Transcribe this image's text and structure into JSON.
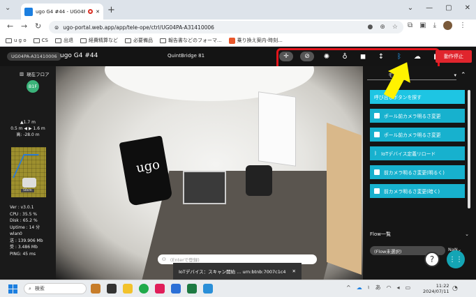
{
  "browser": {
    "tab_title": "ugo G4 #44 - UG04PA-A31...",
    "new_tab": "+",
    "url": "ugo-portal.web.app/app/tele-ope/ctrl/UG04PA-A31410006",
    "window_controls": [
      "⌄",
      "—",
      "▢",
      "✕"
    ],
    "bookmarks": [
      {
        "label": "u g o",
        "type": "folder"
      },
      {
        "label": "CS",
        "type": "folder"
      },
      {
        "label": "出退",
        "type": "folder"
      },
      {
        "label": "経費精算など",
        "type": "folder"
      },
      {
        "label": "必要備品",
        "type": "folder"
      },
      {
        "label": "報告書などのフォーマ...",
        "type": "folder"
      },
      {
        "label": "乗り換え案内-時刻...",
        "type": "site"
      }
    ]
  },
  "app": {
    "robot_id": "UG04PA-A31410006",
    "robot_name": "ugo G4 #44",
    "location": "QuintBridge 81",
    "stop_button": "動作停止",
    "toolbar_icons": [
      "pointer-plus-icon",
      "mic-off-icon",
      "light-off-icon",
      "bulb-icon",
      "frame-icon",
      "height-icon",
      "bluetooth-icon",
      "cloud-icon",
      "battery-icon",
      "camera-switch-icon"
    ],
    "left_panel": {
      "floor_label": "現在フロア",
      "floor_value": "B1F",
      "height_top": "▲1.7 m",
      "height_range": "0.5 m ◀ ▶ 1.6 m",
      "height_mid": "高: -28.0 m",
      "map_scale": "50cm",
      "stats": [
        "Ver : v3.0.1",
        "CPU : 35.5 %",
        "Disk : 65.2 %",
        "Uptime : 14 分",
        "wlan0",
        "送 : 139.906 Mb",
        "受 : 3.486 Mb",
        "PING: 45 ms"
      ]
    },
    "camera": {
      "input_placeholder": "(Enterで登録)",
      "toast_text": "IoTデバイス：スキャン開始 ... urn:btnb:7007c1c4",
      "toast_close": "✕",
      "bag_logo": "ugo"
    },
    "right_panel": {
      "mode_label": "モード 1",
      "actions": [
        "呼び出しボタンを探す",
        "ポール前カメラ明るさ変更",
        "ポール前カメラ明るさ変更",
        "IoTデバイス定義リロード",
        "前カメラ明るさ変更(明るく)",
        "前カメラ明るさ変更(暗く)"
      ],
      "flow_title": "Flow一覧",
      "flow_value": "(Flow未選択)",
      "flow_nan": "NaN"
    },
    "help_label": "?",
    "grid_label": "⋮⋮"
  },
  "taskbar": {
    "search_placeholder": "検索",
    "time": "11:22",
    "date": "2024/07/11"
  }
}
